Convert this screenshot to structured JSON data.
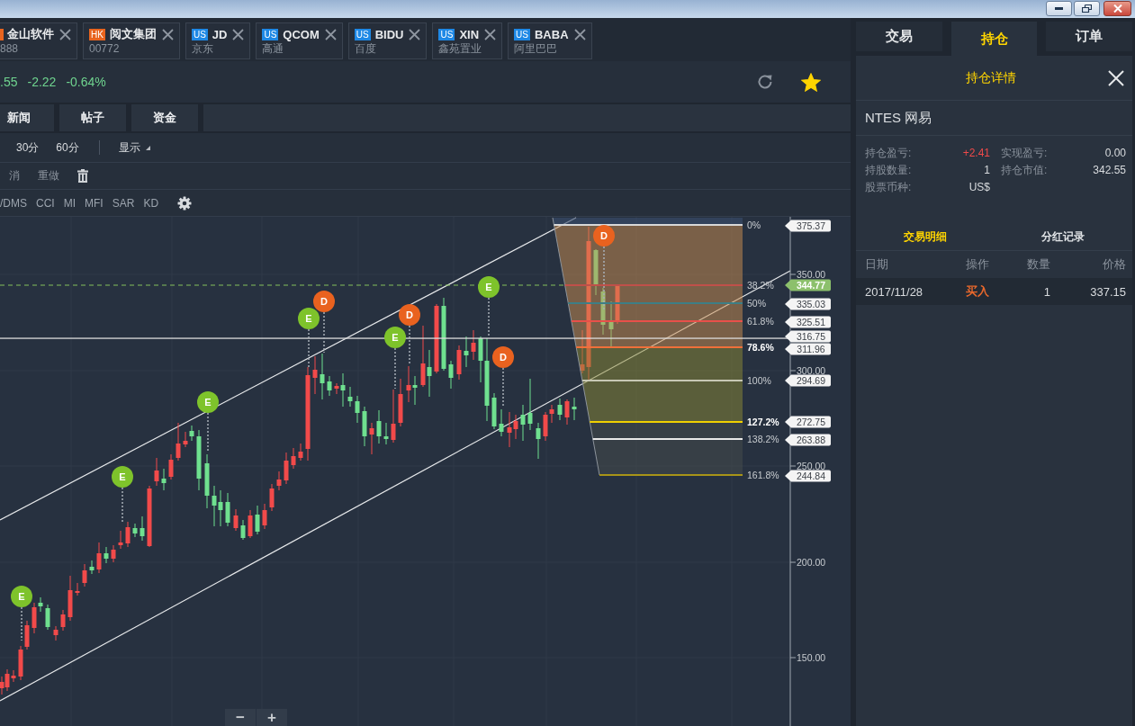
{
  "stock_tabs": [
    {
      "color": "#e8641e",
      "title": "金山软件",
      "subtitle": "888"
    },
    {
      "market": "HK",
      "color": "#e8641e",
      "title": "阅文集团",
      "subtitle": "00772"
    },
    {
      "market": "US",
      "color": "#1e88e5",
      "title": "JD",
      "subtitle": "京东"
    },
    {
      "market": "US",
      "color": "#1e88e5",
      "title": "QCOM",
      "subtitle": "高通"
    },
    {
      "market": "US",
      "color": "#1e88e5",
      "title": "BIDU",
      "subtitle": "百度"
    },
    {
      "market": "US",
      "color": "#1e88e5",
      "title": "XIN",
      "subtitle": "鑫苑置业"
    },
    {
      "market": "US",
      "color": "#1e88e5",
      "title": "BABA",
      "subtitle": "阿里巴巴"
    }
  ],
  "quote": {
    "price": ".55",
    "change": "-2.22",
    "change_percent": "-0.64%",
    "favorite": true
  },
  "info_tabs": [
    "新闻",
    "帖子",
    "资金"
  ],
  "periods": [
    "30分",
    "60分"
  ],
  "display_menu": "显示",
  "edit_tools": [
    "消",
    "重做"
  ],
  "indicators": [
    "/DMS",
    "CCI",
    "MI",
    "MFI",
    "SAR",
    "KD"
  ],
  "chart": {
    "y_axis_labels": [
      "350.00",
      "300.00",
      "250.00",
      "200.00",
      "150.00"
    ],
    "fib_levels": [
      {
        "label": "0%",
        "price": "375.37",
        "color": "#d8d8d8",
        "emphasized": false
      },
      {
        "label": "38.2%",
        "color": "#c0504a",
        "emphasized": false
      },
      {
        "label": "50%",
        "price": "335.03",
        "color": "#3d7f86",
        "emphasized": false
      },
      {
        "label": "61.8%",
        "price": "325.51",
        "color": "#e8504a",
        "emphasized": false
      },
      {
        "label": "78.6%",
        "price": "311.96",
        "color": "#f0703a",
        "emphasized": true
      },
      {
        "label": "100%",
        "price": "294.69",
        "color": "#c8c8b4",
        "emphasized": false
      },
      {
        "label": "127.2%",
        "price": "272.75",
        "color": "#f0d000",
        "emphasized": true
      },
      {
        "label": "138.2%",
        "price": "263.88",
        "color": "#e8e8e8",
        "emphasized": false
      },
      {
        "label": "161.8%",
        "price": "244.84",
        "color": "#a89418",
        "emphasized": false
      }
    ],
    "current_price": "344.77",
    "line_price": "316.75",
    "markers": [
      {
        "label": "E",
        "color": "#7ec32b"
      },
      {
        "label": "E",
        "color": "#7ec32b"
      },
      {
        "label": "E",
        "color": "#7ec32b"
      },
      {
        "label": "E",
        "color": "#7ec32b"
      },
      {
        "label": "D",
        "color": "#e9621f"
      },
      {
        "label": "E",
        "color": "#7ec32b"
      },
      {
        "label": "D",
        "color": "#e9621f"
      },
      {
        "label": "E",
        "color": "#7ec32b"
      },
      {
        "label": "D",
        "color": "#e9621f"
      },
      {
        "label": "D",
        "color": "#e9621f"
      }
    ],
    "zoom_buttons": [
      "−",
      "+"
    ]
  },
  "side_tabs": [
    {
      "label": "交易",
      "selected": false
    },
    {
      "label": "持仓",
      "selected": true
    },
    {
      "label": "订单",
      "selected": false
    }
  ],
  "position_panel": {
    "title": "持仓详情",
    "symbol": "NTES 网易",
    "details": [
      {
        "label": "持仓盈亏:",
        "value": "+2.41",
        "color": "#f04a4a"
      },
      {
        "label": "实现盈亏:",
        "value": "0.00"
      },
      {
        "label": "持股数量:",
        "value": "1"
      },
      {
        "label": "持仓市值:",
        "value": "342.55"
      },
      {
        "label": "股票币种:",
        "value": "US$"
      }
    ],
    "record_tabs": [
      {
        "label": "交易明细",
        "selected": true
      },
      {
        "label": "分红记录",
        "selected": false
      }
    ],
    "table": {
      "columns": [
        "日期",
        "操作",
        "数量",
        "价格"
      ],
      "rows": [
        {
          "cells": [
            "2017/11/28",
            "买入",
            "1",
            "337.15"
          ],
          "color": "#e8682c"
        }
      ]
    }
  }
}
